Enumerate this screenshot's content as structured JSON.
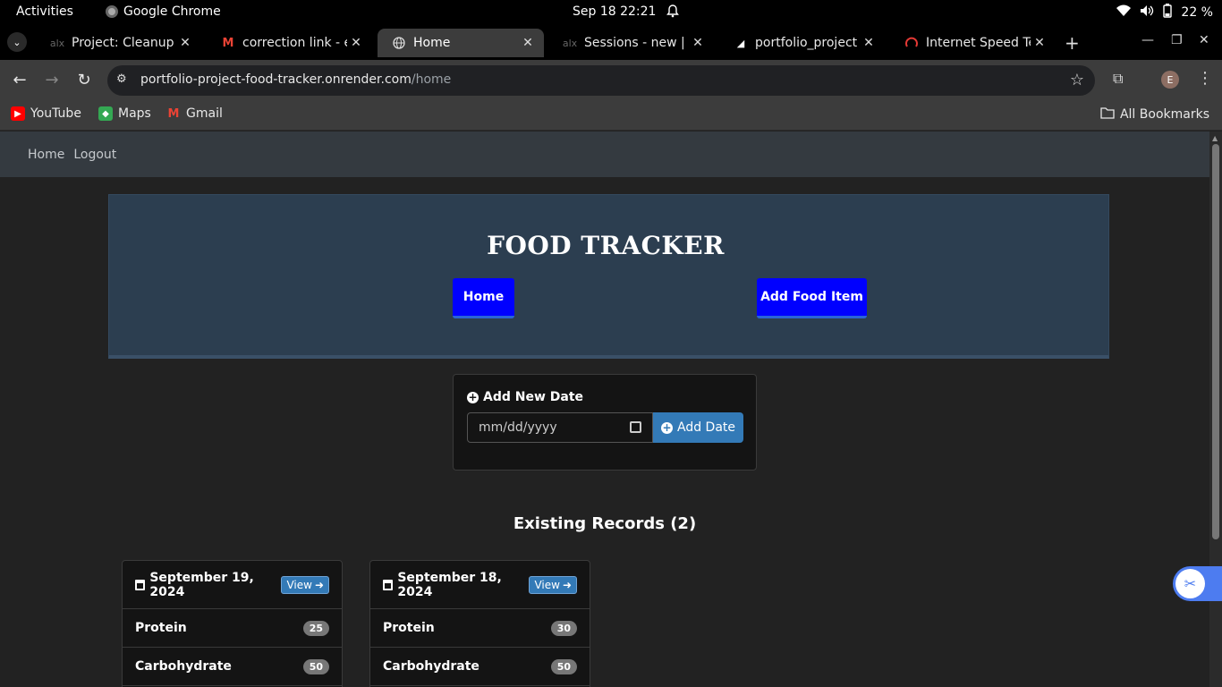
{
  "system_bar": {
    "activities": "Activities",
    "app_name": "Google Chrome",
    "clock": "Sep 18  22:21",
    "battery": "22 %"
  },
  "tabs": [
    {
      "title": "Project: Cleanup y",
      "icon": "alx-icon"
    },
    {
      "title": "correction link - e",
      "icon": "gmail-icon"
    },
    {
      "title": "Home",
      "icon": "globe-icon"
    },
    {
      "title": "Sessions - new | In",
      "icon": "alx-icon"
    },
    {
      "title": "portfolio_project",
      "icon": "render-icon"
    },
    {
      "title": "Internet Speed Te",
      "icon": "speedtest-icon"
    }
  ],
  "address_bar": {
    "host": "portfolio-project-food-tracker.onrender.com",
    "path": "/home"
  },
  "profile_initial": "E",
  "bookmarks": {
    "items": [
      {
        "label": "YouTube",
        "color": "#ff0000"
      },
      {
        "label": "Maps",
        "color": "#34a853"
      },
      {
        "label": "Gmail",
        "color": "#ea4335"
      }
    ],
    "all_bookmarks": "All Bookmarks"
  },
  "site_nav": {
    "home": "Home",
    "logout": "Logout"
  },
  "hero": {
    "title": "FOOD TRACKER",
    "home_button": "Home",
    "add_food_button": "Add Food Item"
  },
  "add_date": {
    "label": "Add New Date",
    "placeholder": "mm/dd/yyyy",
    "button": "Add Date"
  },
  "records_title": "Existing Records (2)",
  "records": [
    {
      "date": "September 19, 2024",
      "view": "View",
      "rows": [
        {
          "name": "Protein",
          "value": "25"
        },
        {
          "name": "Carbohydrate",
          "value": "50"
        }
      ]
    },
    {
      "date": "September 18, 2024",
      "view": "View",
      "rows": [
        {
          "name": "Protein",
          "value": "30"
        },
        {
          "name": "Carbohydrate",
          "value": "50"
        }
      ]
    }
  ],
  "colors": {
    "primary_button": "#0000ff",
    "accent_blue": "#337ab7",
    "hero_bg": "#2c3e50",
    "nav_bg": "#343a40"
  }
}
